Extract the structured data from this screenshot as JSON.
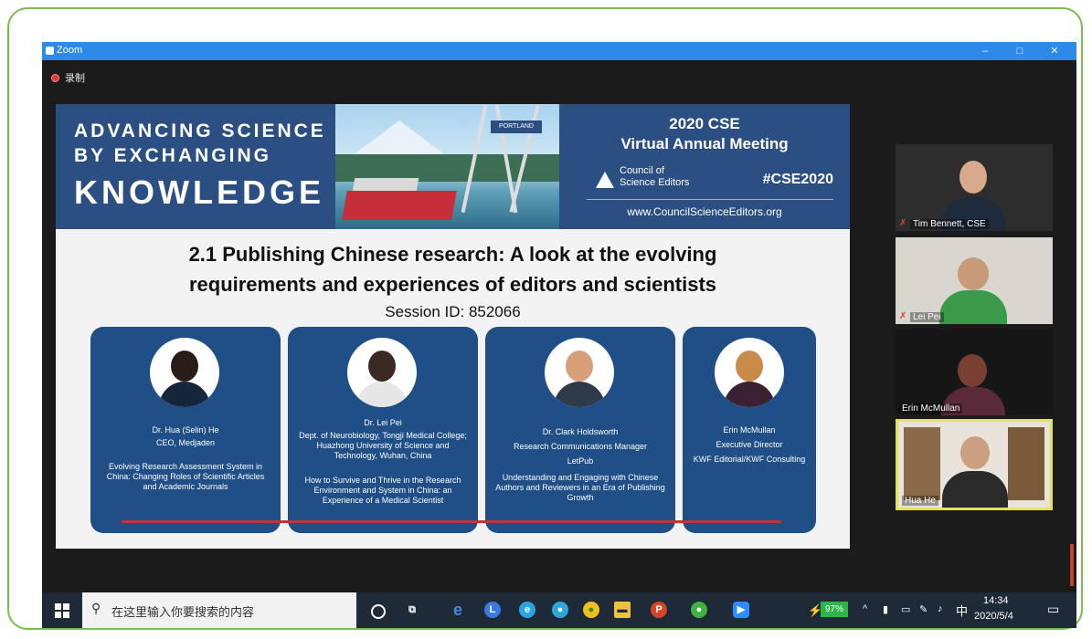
{
  "window": {
    "title": "Zoom",
    "controls": {
      "minimize": "–",
      "maximize": "□",
      "close": "✕"
    }
  },
  "recording": {
    "label": "录制"
  },
  "slide": {
    "banner": {
      "left_line1": "ADVANCING SCIENCE",
      "left_line2": "BY EXCHANGING",
      "left_line3": "KNOWLEDGE",
      "image_sign": "PORTLAND",
      "event_line1": "2020 CSE",
      "event_line2": "Virtual Annual Meeting",
      "org_line1": "Council of",
      "org_line2": "Science Editors",
      "hashtag": "#CSE2020",
      "url": "www.CouncilScienceEditors.org"
    },
    "title_line1": "2.1 Publishing Chinese research: A look at the evolving",
    "title_line2": "requirements and experiences of editors and scientists",
    "session_id": "Session ID: 852066",
    "speakers": [
      {
        "name": "Dr. Hua (Selin) He",
        "role": "CEO, Medjaden",
        "org": "",
        "talk": "Evolving Research Assessment System in China: Changing Roles of Scientific Articles and Academic Journals"
      },
      {
        "name": "Dr. Lei Pei",
        "role": "Dept. of Neurobiology, Tongji Medical College; Huazhong University of Science and Technology, Wuhan, China",
        "org": "",
        "talk": "How to Survive and Thrive in the Research Environment and System in China: an Experience of a Medical Scientist"
      },
      {
        "name": "Dr. Clark Holdsworth",
        "role": "Research Communications Manager",
        "org": "LetPub",
        "talk": "Understanding and Engaging with Chinese Authors and Reviewers in an Era of Publishing Growth"
      },
      {
        "name": "Erin McMullan",
        "role": "Executive Director",
        "org": "KWF Editorial/KWF Consulting",
        "talk": ""
      }
    ]
  },
  "participants": [
    {
      "name": "Tim Bennett, CSE",
      "muted": true
    },
    {
      "name": "Lei Pei",
      "muted": true
    },
    {
      "name": "Erin McMullan",
      "muted": false
    },
    {
      "name": "Hua He",
      "muted": false,
      "active_speaker": true
    }
  ],
  "taskbar": {
    "search_placeholder": "在这里输入你要搜索的内容",
    "icons": [
      "cortana-icon",
      "task-view-icon",
      "edge-icon",
      "clock-app-icon",
      "ie-icon",
      "chrome-icon",
      "file-explorer-icon",
      "powerpoint-icon",
      "wechat-icon",
      "zoom-icon"
    ],
    "battery": "97%",
    "ime": "中",
    "time": "14:34",
    "date": "2020/5/4"
  },
  "colors": {
    "frame_border": "#79be4a",
    "titlebar": "#2d8ae8",
    "slide_blue": "#2b4f83",
    "card_blue": "#1f4f86",
    "active_speaker_border": "#e3e35a"
  }
}
